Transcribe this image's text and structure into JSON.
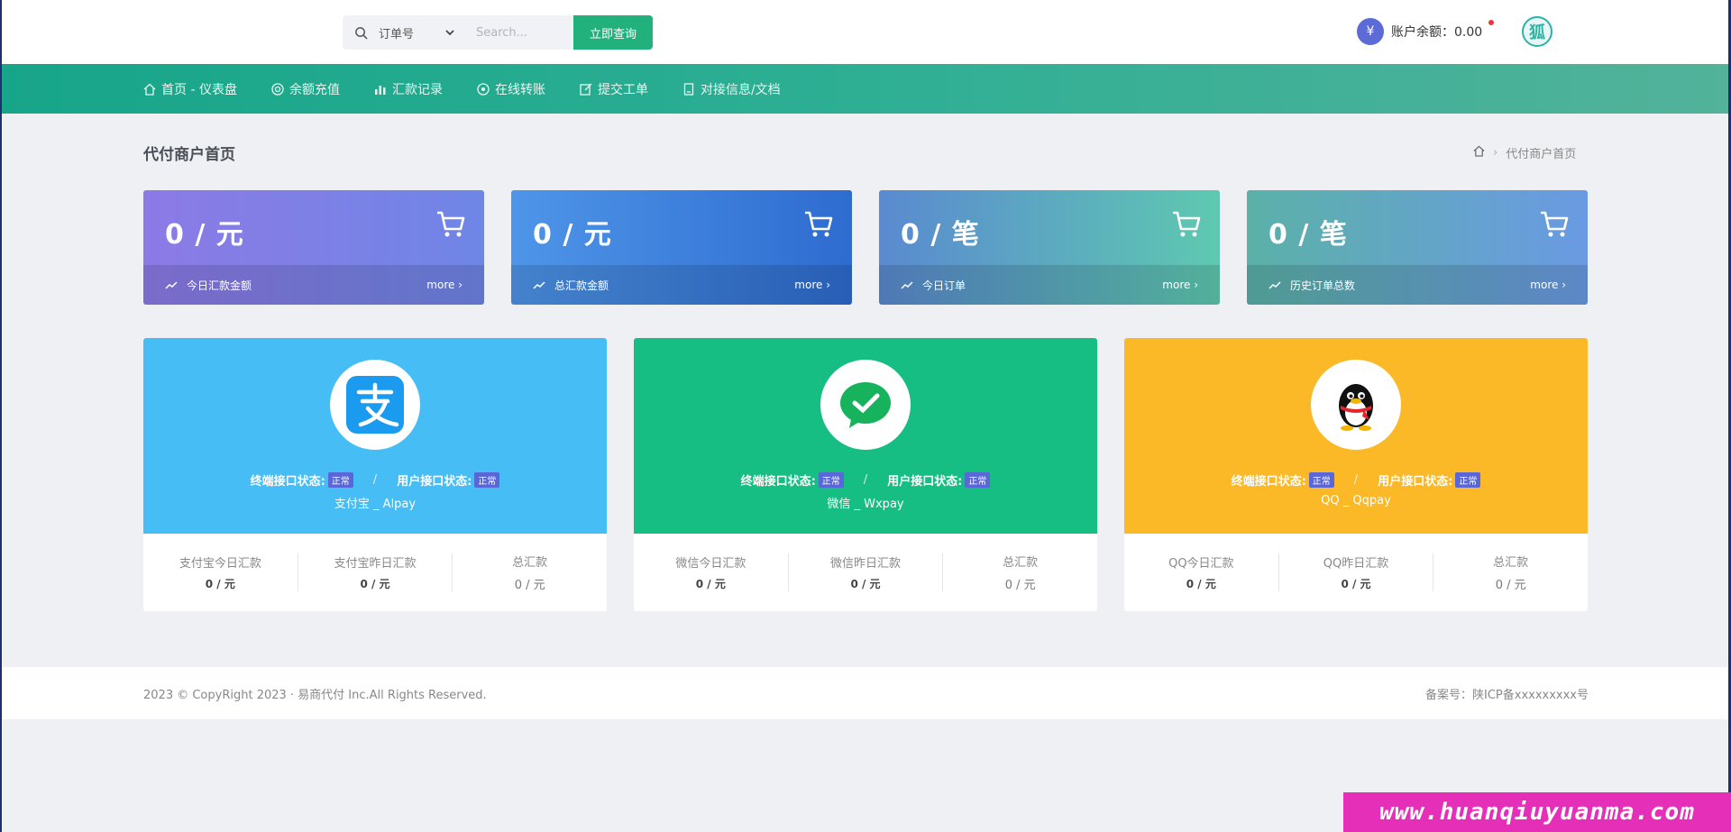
{
  "search": {
    "type_label": "订单号",
    "placeholder": "Search...",
    "button_label": "立即查询"
  },
  "account": {
    "yen_symbol": "¥",
    "balance_label": "账户余额：0.00",
    "avatar_char": "狐"
  },
  "nav": [
    {
      "label": "首页 - 仪表盘",
      "icon": "home-icon"
    },
    {
      "label": "余额充值",
      "icon": "target-icon"
    },
    {
      "label": "汇款记录",
      "icon": "bar-chart-icon"
    },
    {
      "label": "在线转账",
      "icon": "transfer-icon"
    },
    {
      "label": "提交工单",
      "icon": "edit-icon"
    },
    {
      "label": "对接信息/文档",
      "icon": "document-icon"
    }
  ],
  "page": {
    "title": "代付商户首页",
    "breadcrumb_current": "代付商户首页"
  },
  "stats": [
    {
      "value": "0 / 元",
      "label": "今日汇款金额",
      "more": "more"
    },
    {
      "value": "0 / 元",
      "label": "总汇款金额",
      "more": "more"
    },
    {
      "value": "0 / 笔",
      "label": "今日订单",
      "more": "more"
    },
    {
      "value": "0 / 笔",
      "label": "历史订单总数",
      "more": "more"
    }
  ],
  "pay_cards": [
    {
      "name": "支付宝 _ Alpay",
      "terminal_label": "终端接口状态:",
      "user_label": "用户接口状态:",
      "status_tag": "正常",
      "slash": "/",
      "cells": [
        {
          "title": "支付宝今日汇款",
          "value": "0 / 元"
        },
        {
          "title": "支付宝昨日汇款",
          "value": "0 / 元"
        },
        {
          "title": "总汇款",
          "value": "0 / 元"
        }
      ]
    },
    {
      "name": "微信 _ Wxpay",
      "terminal_label": "终端接口状态:",
      "user_label": "用户接口状态:",
      "status_tag": "正常",
      "slash": "/",
      "cells": [
        {
          "title": "微信今日汇款",
          "value": "0 / 元"
        },
        {
          "title": "微信昨日汇款",
          "value": "0 / 元"
        },
        {
          "title": "总汇款",
          "value": "0 / 元"
        }
      ]
    },
    {
      "name": "QQ _ Qqpay",
      "terminal_label": "终端接口状态:",
      "user_label": "用户接口状态:",
      "status_tag": "正常",
      "slash": "/",
      "cells": [
        {
          "title": "QQ今日汇款",
          "value": "0 / 元"
        },
        {
          "title": "QQ昨日汇款",
          "value": "0 / 元"
        },
        {
          "title": "总汇款",
          "value": "0 / 元"
        }
      ]
    }
  ],
  "footer": {
    "copyright": "2023 © CopyRight 2023 · 易商代付 Inc.All Rights Reserved.",
    "icp": "备案号：陕ICP备xxxxxxxxx号"
  },
  "watermark": "www.huanqiuyuanma.com"
}
